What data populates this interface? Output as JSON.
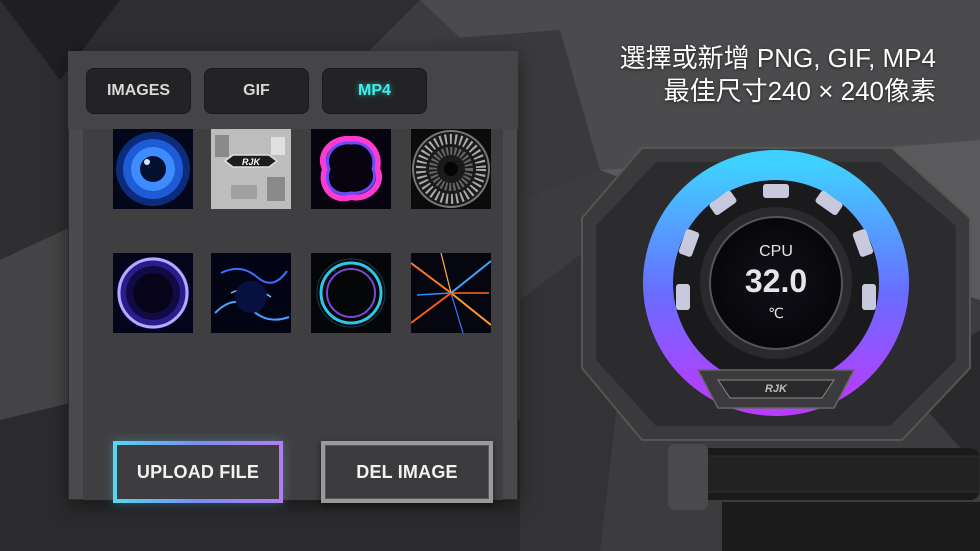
{
  "tabs": [
    {
      "label": "IMAGES",
      "active": false
    },
    {
      "label": "GIF",
      "active": false
    },
    {
      "label": "MP4",
      "active": true
    }
  ],
  "thumbnails": [
    {
      "name": "thumb-blue-eye"
    },
    {
      "name": "thumb-rjk-logo",
      "logo_text": "RJK"
    },
    {
      "name": "thumb-neon-ring-pink"
    },
    {
      "name": "thumb-turbine"
    },
    {
      "name": "thumb-electric-sphere"
    },
    {
      "name": "thumb-blue-energy"
    },
    {
      "name": "thumb-neon-ring-cyan"
    },
    {
      "name": "thumb-light-streaks"
    }
  ],
  "buttons": {
    "upload_label": "UPLOAD FILE",
    "delete_label": "DEL IMAGE"
  },
  "heading": {
    "line1": "選擇或新增 PNG, GIF, MP4",
    "line2": "最佳尺寸240 × 240像素"
  },
  "pump_display": {
    "label": "CPU",
    "value": "32.0",
    "unit": "℃",
    "logo_text": "RJK"
  },
  "colors": {
    "active_tab": "#3ff0e8",
    "ring_top": "#3fc8ff",
    "ring_bottom": "#b040ff"
  }
}
